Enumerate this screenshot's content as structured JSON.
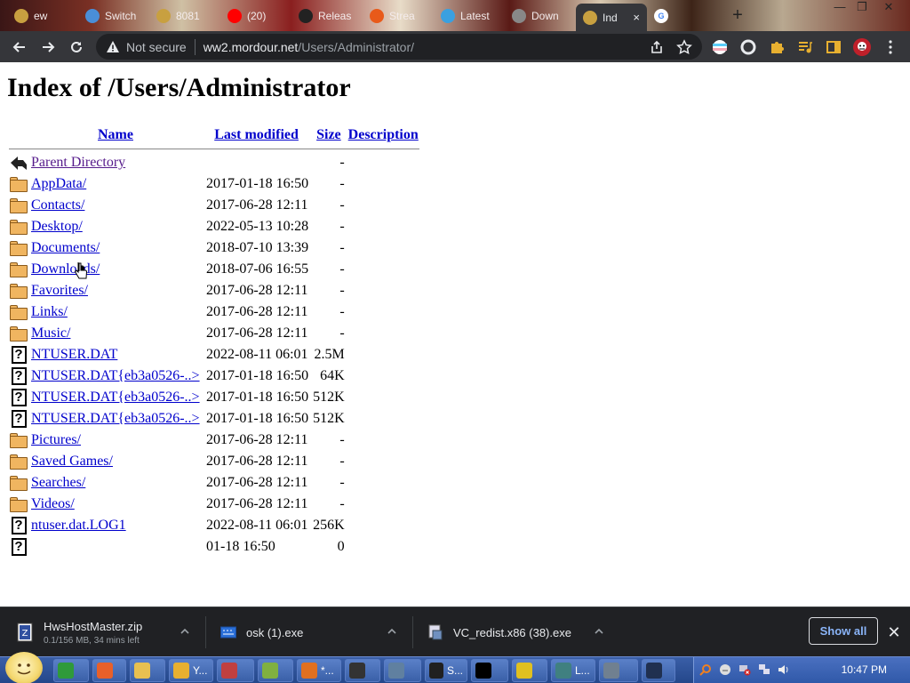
{
  "browser": {
    "tabs": [
      {
        "label": "ew",
        "favicon": "chrome-icon",
        "color": "#c8a040"
      },
      {
        "label": "Switch",
        "favicon": "gear-icon",
        "color": "#4a8ed8"
      },
      {
        "label": "8081",
        "favicon": "chrome-icon",
        "color": "#c8a040"
      },
      {
        "label": "(20)",
        "favicon": "youtube-icon",
        "color": "#ff0000"
      },
      {
        "label": "Releas",
        "favicon": "github-icon",
        "color": "#222222"
      },
      {
        "label": "Strea",
        "favicon": "stream-icon",
        "color": "#e85a1a"
      },
      {
        "label": "Latest",
        "favicon": "microsoft-icon",
        "color": "#3aa0e0"
      },
      {
        "label": "Down",
        "favicon": "download-icon",
        "color": "#888888"
      },
      {
        "label": "Ind",
        "favicon": "chrome-icon",
        "color": "#c8a040",
        "active": true
      },
      {
        "label": "",
        "favicon": "google-icon",
        "color": "#4285f4"
      }
    ],
    "tab_close": "×",
    "new_tab": "+",
    "security_text": "Not secure",
    "url_host": "ww2.mordour.net",
    "url_path": "/Users/Administrator/"
  },
  "page": {
    "title": "Index of /Users/Administrator",
    "columns": {
      "name": "Name",
      "modified": "Last modified",
      "size": "Size",
      "description": "Description"
    },
    "rows": [
      {
        "icon": "back",
        "name": "Parent Directory",
        "modified": "",
        "size": "-",
        "visited": true
      },
      {
        "icon": "folder",
        "name": "AppData/",
        "modified": "2017-01-18 16:50",
        "size": "-"
      },
      {
        "icon": "folder",
        "name": "Contacts/",
        "modified": "2017-06-28 12:11",
        "size": "-"
      },
      {
        "icon": "folder",
        "name": "Desktop/",
        "modified": "2022-05-13 10:28",
        "size": "-"
      },
      {
        "icon": "folder",
        "name": "Documents/",
        "modified": "2018-07-10 13:39",
        "size": "-"
      },
      {
        "icon": "folder",
        "name": "Downloads/",
        "modified": "2018-07-06 16:55",
        "size": "-"
      },
      {
        "icon": "folder",
        "name": "Favorites/",
        "modified": "2017-06-28 12:11",
        "size": "-"
      },
      {
        "icon": "folder",
        "name": "Links/",
        "modified": "2017-06-28 12:11",
        "size": "-"
      },
      {
        "icon": "folder",
        "name": "Music/",
        "modified": "2017-06-28 12:11",
        "size": "-"
      },
      {
        "icon": "unknown",
        "name": "NTUSER.DAT",
        "modified": "2022-08-11 06:01",
        "size": "2.5M"
      },
      {
        "icon": "unknown",
        "name": "NTUSER.DAT{eb3a0526-..>",
        "modified": "2017-01-18 16:50",
        "size": "64K"
      },
      {
        "icon": "unknown",
        "name": "NTUSER.DAT{eb3a0526-..>",
        "modified": "2017-01-18 16:50",
        "size": "512K"
      },
      {
        "icon": "unknown",
        "name": "NTUSER.DAT{eb3a0526-..>",
        "modified": "2017-01-18 16:50",
        "size": "512K"
      },
      {
        "icon": "folder",
        "name": "Pictures/",
        "modified": "2017-06-28 12:11",
        "size": "-"
      },
      {
        "icon": "folder",
        "name": "Saved Games/",
        "modified": "2017-06-28 12:11",
        "size": "-"
      },
      {
        "icon": "folder",
        "name": "Searches/",
        "modified": "2017-06-28 12:11",
        "size": "-"
      },
      {
        "icon": "folder",
        "name": "Videos/",
        "modified": "2017-06-28 12:11",
        "size": "-"
      },
      {
        "icon": "unknown",
        "name": "ntuser.dat.LOG1",
        "modified": "2022-08-11 06:01",
        "size": "256K"
      },
      {
        "icon": "unknown",
        "name": "",
        "modified": "01-18 16:50",
        "size": "0"
      }
    ]
  },
  "downloads": {
    "items": [
      {
        "name": "HwsHostMaster.zip",
        "status": "0.1/156 MB, 34 mins left",
        "icon": "zip-icon"
      },
      {
        "name": "osk (1).exe",
        "status": "",
        "icon": "keyboard-icon"
      },
      {
        "name": "VC_redist.x86 (38).exe",
        "status": "",
        "icon": "installer-icon"
      }
    ],
    "show_all": "Show all",
    "close": "✕"
  },
  "taskbar": {
    "buttons": [
      {
        "label": "",
        "icon": "chrome-icon",
        "color": "#2f9a3a"
      },
      {
        "label": "",
        "icon": "firefox-icon",
        "color": "#e8602a"
      },
      {
        "label": "",
        "icon": "folder-icon",
        "color": "#e8c050"
      },
      {
        "label": "Y...",
        "icon": "emoji-icon",
        "color": "#e8b030"
      },
      {
        "label": "",
        "icon": "app-icon",
        "color": "#c04040"
      },
      {
        "label": "",
        "icon": "notepad-icon",
        "color": "#80b040"
      },
      {
        "label": "*...",
        "icon": "search-icon",
        "color": "#e07020"
      },
      {
        "label": "",
        "icon": "7zip-icon",
        "color": "#333333"
      },
      {
        "label": "",
        "icon": "network-icon",
        "color": "#6080a0"
      },
      {
        "label": "S...",
        "icon": "terminal-icon",
        "color": "#202020"
      },
      {
        "label": "",
        "icon": "cmd-icon",
        "color": "#000000"
      },
      {
        "label": "",
        "icon": "shield-icon",
        "color": "#e0c020"
      },
      {
        "label": "L...",
        "icon": "window-icon",
        "color": "#408080"
      },
      {
        "label": "",
        "icon": "monitor-icon",
        "color": "#708090"
      },
      {
        "label": "",
        "icon": "globe-icon",
        "color": "#203050"
      }
    ],
    "clock": "10:47 PM"
  }
}
